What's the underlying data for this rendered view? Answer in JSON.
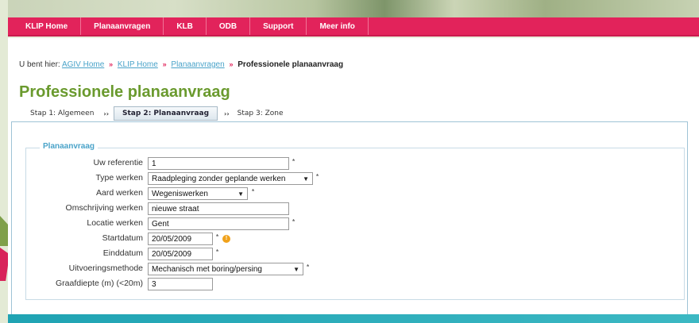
{
  "nav": {
    "items": [
      "KLIP Home",
      "Planaanvragen",
      "KLB",
      "ODB",
      "Support",
      "Meer info"
    ]
  },
  "breadcrumb": {
    "prefix": "U bent hier:",
    "links": [
      "AGIV Home",
      "KLIP Home",
      "Planaanvragen"
    ],
    "separator": "»",
    "current": "Professionele planaanvraag"
  },
  "page": {
    "title": "Professionele planaanvraag"
  },
  "steps": [
    {
      "label": "Stap 1: Algemeen",
      "active": false
    },
    {
      "label": "Stap 2: Planaanvraag",
      "active": true
    },
    {
      "label": "Stap 3: Zone",
      "active": false
    }
  ],
  "steps_arrow": "››",
  "form": {
    "legend": "Planaanvraag",
    "required_marker": "*",
    "fields": {
      "uw_referentie": {
        "label": "Uw referentie",
        "value": "1"
      },
      "type_werken": {
        "label": "Type werken",
        "value": "Raadpleging zonder geplande werken"
      },
      "aard_werken": {
        "label": "Aard werken",
        "value": "Wegeniswerken"
      },
      "omschrijving_werken": {
        "label": "Omschrijving werken",
        "value": "nieuwe straat"
      },
      "locatie_werken": {
        "label": "Locatie werken",
        "value": "Gent"
      },
      "startdatum": {
        "label": "Startdatum",
        "value": "20/05/2009"
      },
      "einddatum": {
        "label": "Einddatum",
        "value": "20/05/2009"
      },
      "uitvoeringsmethode": {
        "label": "Uitvoeringsmethode",
        "value": "Mechanisch met boring/persing"
      },
      "graafdiepte": {
        "label": "Graafdiepte (m) (<20m)",
        "value": "3"
      }
    }
  },
  "colors": {
    "nav_bg": "#e2235b",
    "title_green": "#6a9a2e",
    "link_blue": "#4aa3c9",
    "info_orange": "#f0a21b",
    "bottom_teal": "#1fa3b3"
  }
}
